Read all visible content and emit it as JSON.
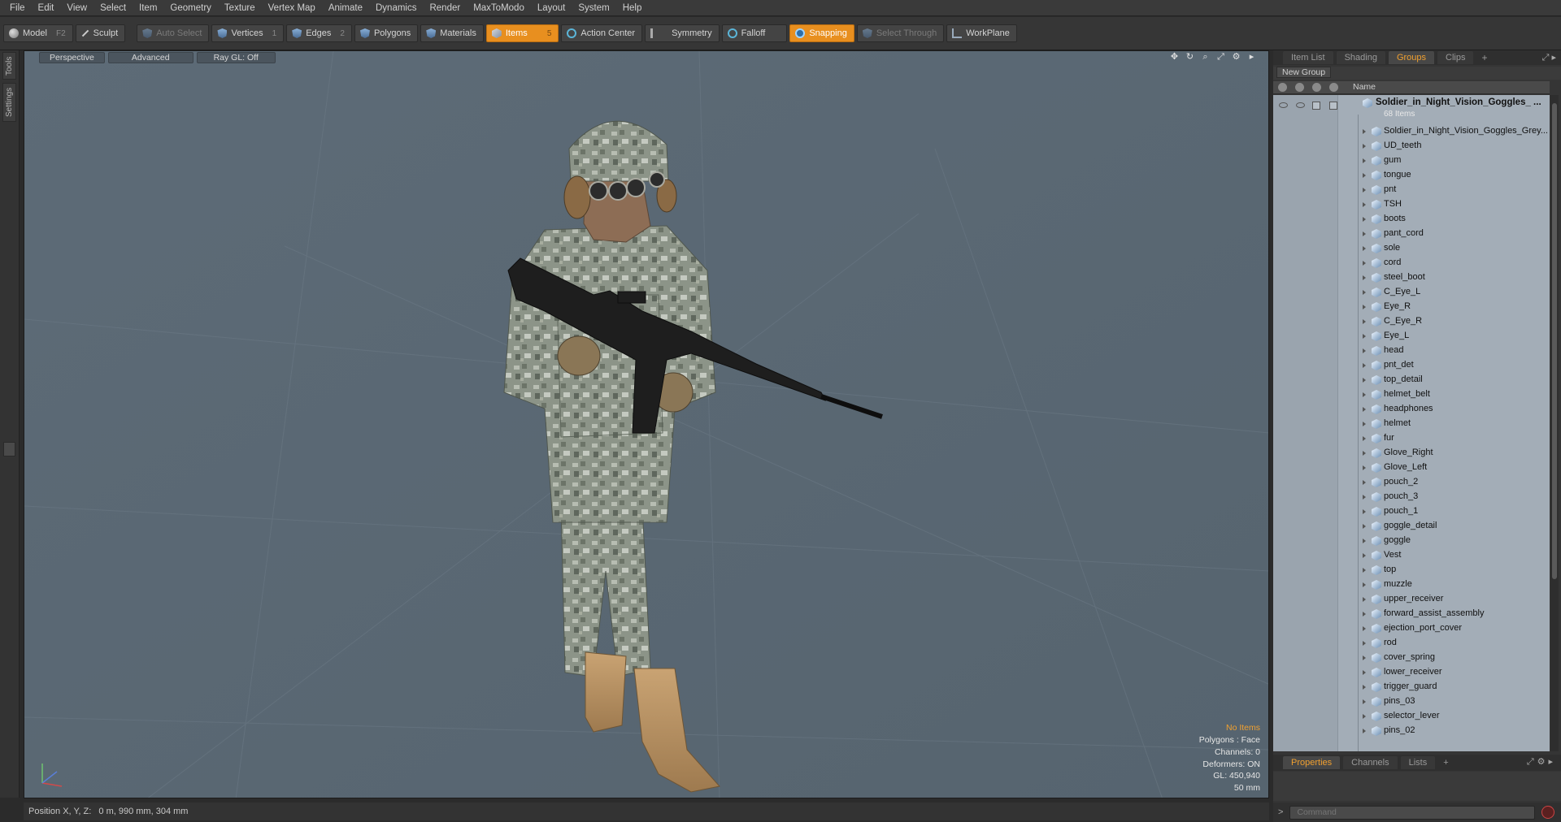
{
  "menu": [
    "File",
    "Edit",
    "View",
    "Select",
    "Item",
    "Geometry",
    "Texture",
    "Vertex Map",
    "Animate",
    "Dynamics",
    "Render",
    "MaxToModo",
    "Layout",
    "System",
    "Help"
  ],
  "toolbar": {
    "model": "Model",
    "model_key": "F2",
    "sculpt": "Sculpt",
    "auto_select": "Auto Select",
    "vertices": "Vertices",
    "vertices_key": "1",
    "edges": "Edges",
    "edges_key": "2",
    "polygons": "Polygons",
    "materials": "Materials",
    "items": "Items",
    "items_key": "5",
    "action_center": "Action Center",
    "symmetry": "Symmetry",
    "falloff": "Falloff",
    "snapping": "Snapping",
    "select_through": "Select Through",
    "workplane": "WorkPlane"
  },
  "left_tabs": [
    "Tools",
    "Settings"
  ],
  "viewport": {
    "view": "Perspective",
    "shading": "Advanced",
    "raygl": "Ray GL: Off",
    "info": {
      "items": "No Items",
      "polygons": "Polygons : Face",
      "channels": "Channels: 0",
      "deformers": "Deformers: ON",
      "gl": "GL: 450,940",
      "lens": "50 mm"
    }
  },
  "status": "Position X, Y, Z:   0 m, 990 mm, 304 mm",
  "panel": {
    "tabs": [
      "Item List",
      "Shading",
      "Groups",
      "Clips"
    ],
    "active_tab": "Groups",
    "new_group": "New Group",
    "column_name": "Name",
    "group_title": "Soldier_in_Night_Vision_Goggles_ ...",
    "group_count": "68 Items",
    "items": [
      "Soldier_in_Night_Vision_Goggles_Grey...",
      "UD_teeth",
      "gum",
      "tongue",
      "pnt",
      "TSH",
      "boots",
      "pant_cord",
      "sole",
      "cord",
      "steel_boot",
      "C_Eye_L",
      "Eye_R",
      "C_Eye_R",
      "Eye_L",
      "head",
      "pnt_det",
      "top_detail",
      "helmet_belt",
      "headphones",
      "helmet",
      "fur",
      "Glove_Right",
      "Glove_Left",
      "pouch_2",
      "pouch_3",
      "pouch_1",
      "goggle_detail",
      "goggle",
      "Vest",
      "top",
      "muzzle",
      "upper_receiver",
      "forward_assist_assembly",
      "ejection_port_cover",
      "rod",
      "cover_spring",
      "lower_receiver",
      "trigger_guard",
      "pins_03",
      "selector_lever",
      "pins_02"
    ],
    "bottom_tabs": [
      "Properties",
      "Channels",
      "Lists"
    ],
    "bottom_active": "Properties",
    "command_placeholder": "Command"
  },
  "colors": {
    "accent": "#e88f1f",
    "viewport_bg": "#5c6a76",
    "list_bg": "#a3adb7"
  }
}
